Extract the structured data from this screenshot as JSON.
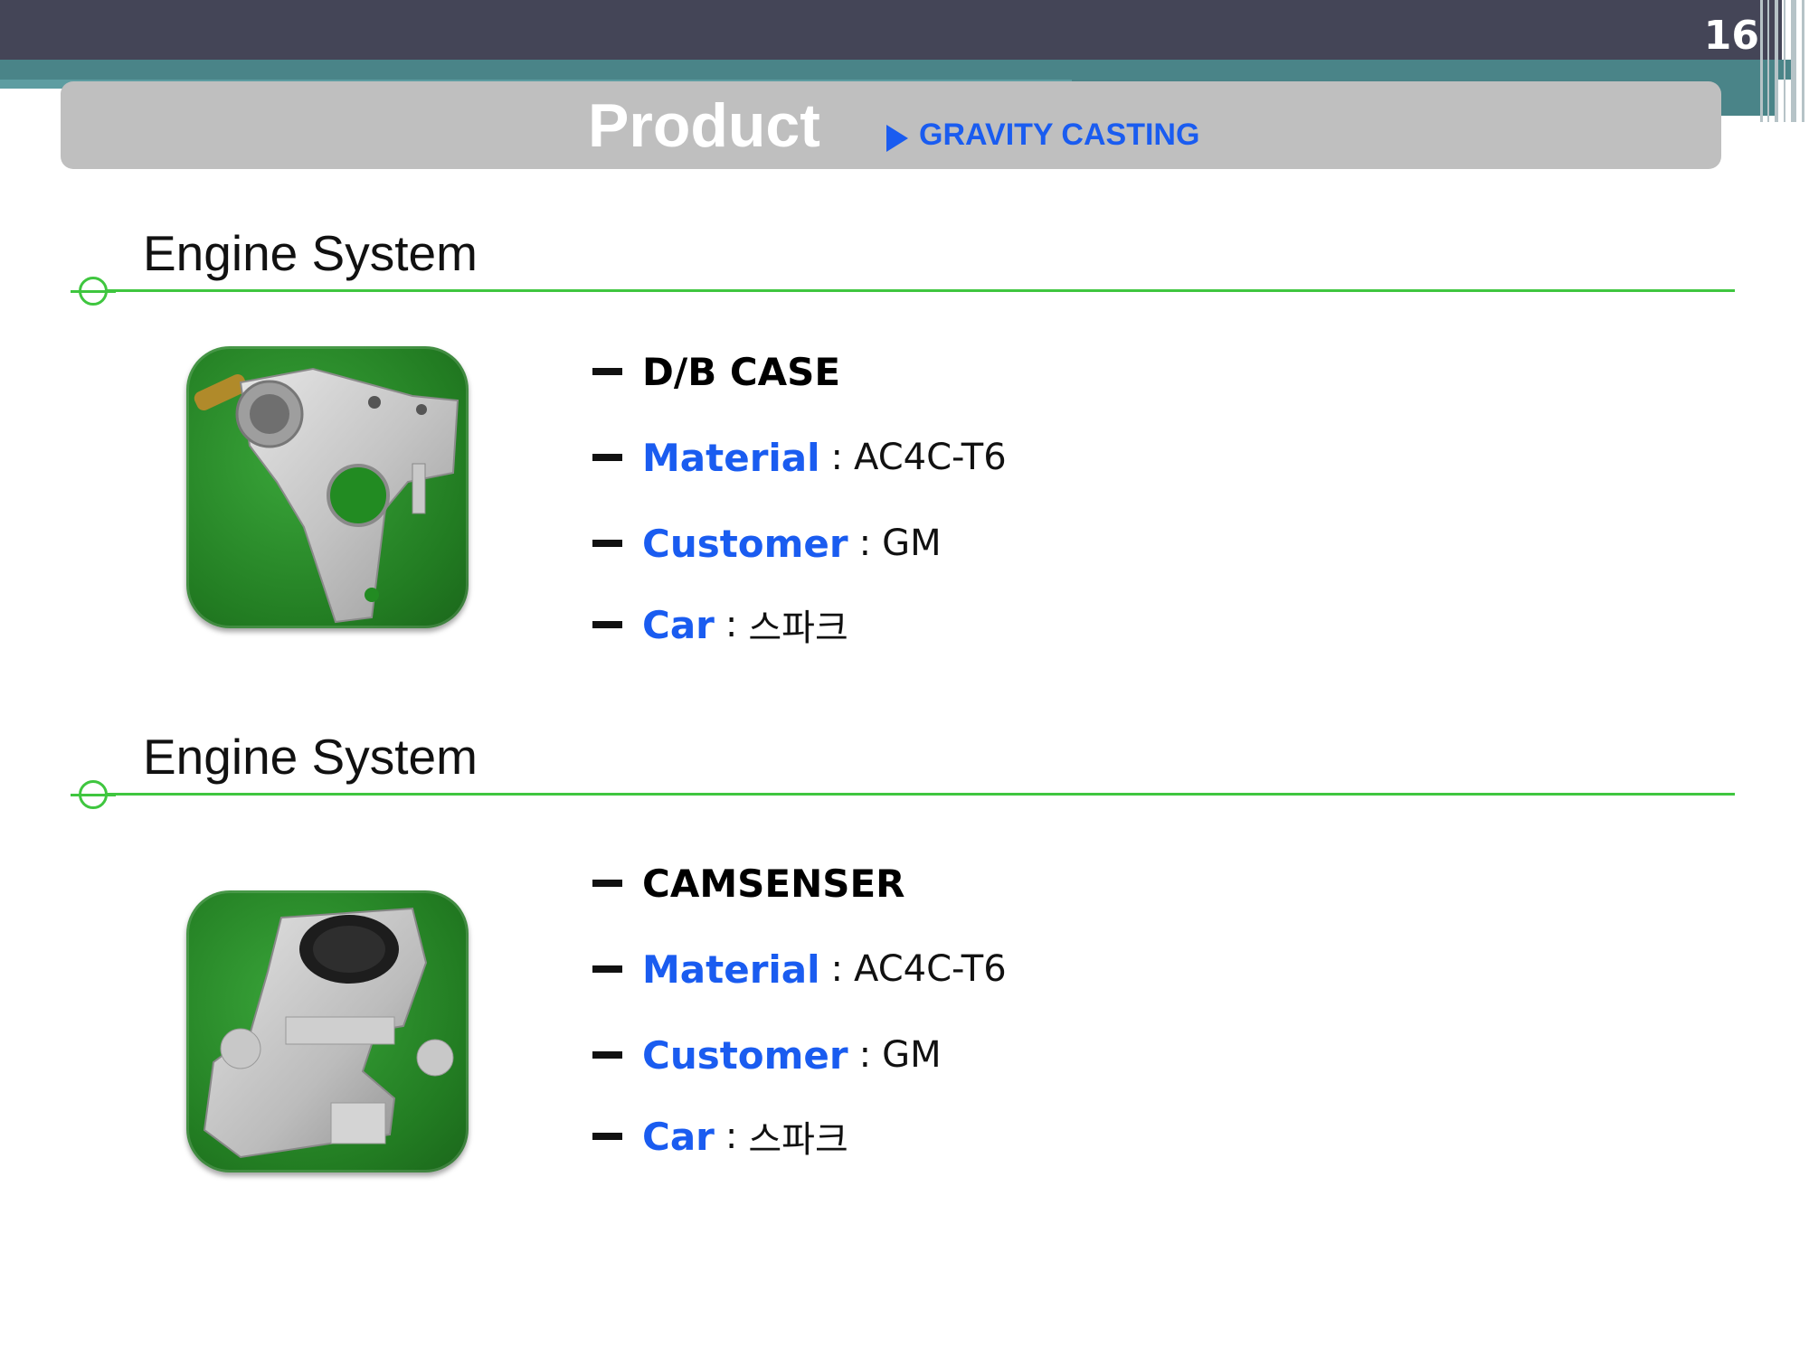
{
  "header": {
    "page_number": "16",
    "title": "Product",
    "subtitle": "GRAVITY CASTING"
  },
  "colors": {
    "accent_blue": "#1a5cf0",
    "section_green": "#3fc63f",
    "banner_dark": "#444557",
    "banner_teal": "#4a8488",
    "title_band": "#bfbfbf"
  },
  "sections": [
    {
      "heading": "Engine System",
      "product_name": "D/B CASE",
      "material_label": "Material",
      "material_value": "AC4C-T6",
      "customer_label": "Customer",
      "customer_value": "GM",
      "car_label": "Car",
      "car_value": "스파크",
      "separator": ":"
    },
    {
      "heading": "Engine System",
      "product_name": "CAMSENSER",
      "material_label": "Material",
      "material_value": "AC4C-T6",
      "customer_label": "Customer",
      "customer_value": "GM",
      "car_label": "Car",
      "car_value": "스파크",
      "separator": ":"
    }
  ]
}
